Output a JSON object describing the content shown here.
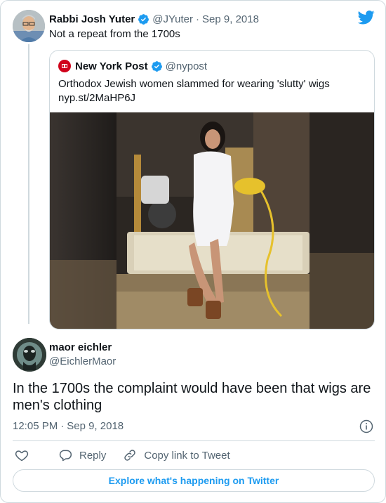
{
  "parent_tweet": {
    "author_name": "Rabbi Josh Yuter",
    "handle": "@JYuter",
    "separator": "·",
    "date": "Sep 9, 2018",
    "text": "Not a repeat from the 1700s"
  },
  "quoted_tweet": {
    "author_name": "New York Post",
    "handle": "@nypost",
    "text": "Orthodox Jewish women slammed for wearing 'slutty' wigs",
    "link": "nyp.st/2MaHP6J"
  },
  "main_tweet": {
    "author_name": "maor eichler",
    "handle": "@EichlerMaor",
    "text": "In the 1700s the complaint would have been that wigs are men's clothing",
    "time": "12:05 PM",
    "separator": "·",
    "date": "Sep 9, 2018"
  },
  "actions": {
    "reply_label": "Reply",
    "copy_link_label": "Copy link to Tweet"
  },
  "explore_label": "Explore what's happening on Twitter",
  "colors": {
    "twitter_blue": "#1d9bf0",
    "verified_blue": "#1d9bf0",
    "nypost_red": "#d0021b",
    "text_secondary": "#536471",
    "border": "#cfd9de"
  },
  "icons": {
    "logo": "twitter-bird-icon",
    "verified": "verified-badge-icon",
    "like": "heart-icon",
    "reply": "reply-bubble-icon",
    "copy": "link-icon",
    "info": "info-icon"
  }
}
